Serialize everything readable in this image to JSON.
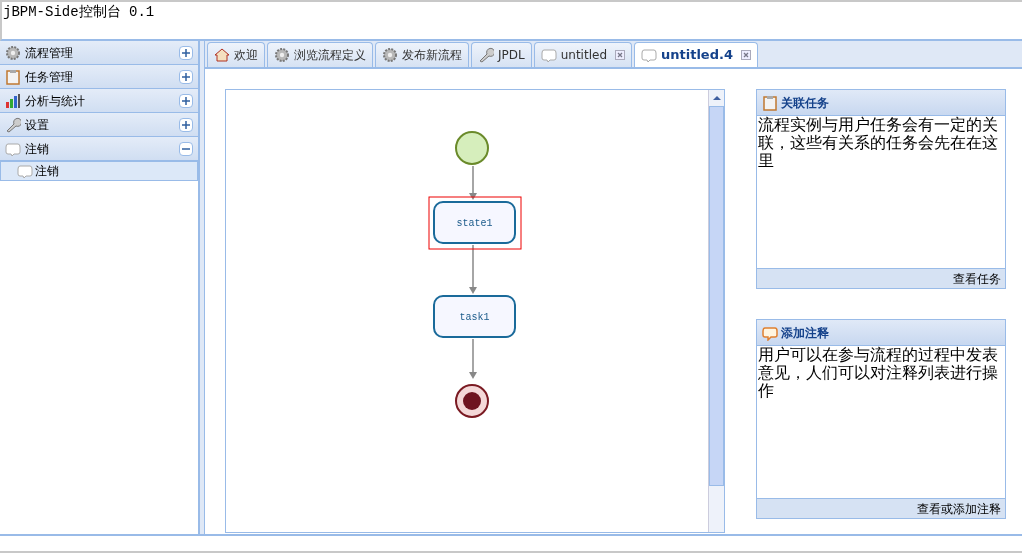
{
  "window": {
    "title": "jBPM-Side控制台 0.1"
  },
  "sidebar": {
    "sections": [
      {
        "label": "流程管理",
        "expanded": false
      },
      {
        "label": "任务管理",
        "expanded": false
      },
      {
        "label": "分析与统计",
        "expanded": false
      },
      {
        "label": "设置",
        "expanded": false
      },
      {
        "label": "注销",
        "expanded": true,
        "children": [
          {
            "label": "注销",
            "selected": true
          }
        ]
      }
    ]
  },
  "tabs": [
    {
      "label": "欢迎",
      "selected": false,
      "closable": false
    },
    {
      "label": "浏览流程定义",
      "selected": false,
      "closable": false
    },
    {
      "label": "发布新流程",
      "selected": false,
      "closable": false
    },
    {
      "label": "JPDL",
      "selected": false,
      "closable": false
    },
    {
      "label": "untitled",
      "selected": false,
      "closable": true
    },
    {
      "label": "untitled.4",
      "selected": true,
      "closable": true
    }
  ],
  "diagram": {
    "nodes": [
      {
        "kind": "start",
        "selected": false
      },
      {
        "kind": "state",
        "label": "state1",
        "selected": true
      },
      {
        "kind": "task",
        "label": "task1",
        "selected": false
      },
      {
        "kind": "end",
        "selected": false
      }
    ]
  },
  "panels": [
    {
      "title": "关联任务",
      "body": "流程实例与用户任务会有一定的关联，这些有关系的任务会先在在这里",
      "footer": "查看任务"
    },
    {
      "title": "添加注释",
      "body": "用户可以在参与流程的过程中发表意见，人们可以对注释列表进行操作",
      "footer": "查看或添加注释"
    }
  ]
}
